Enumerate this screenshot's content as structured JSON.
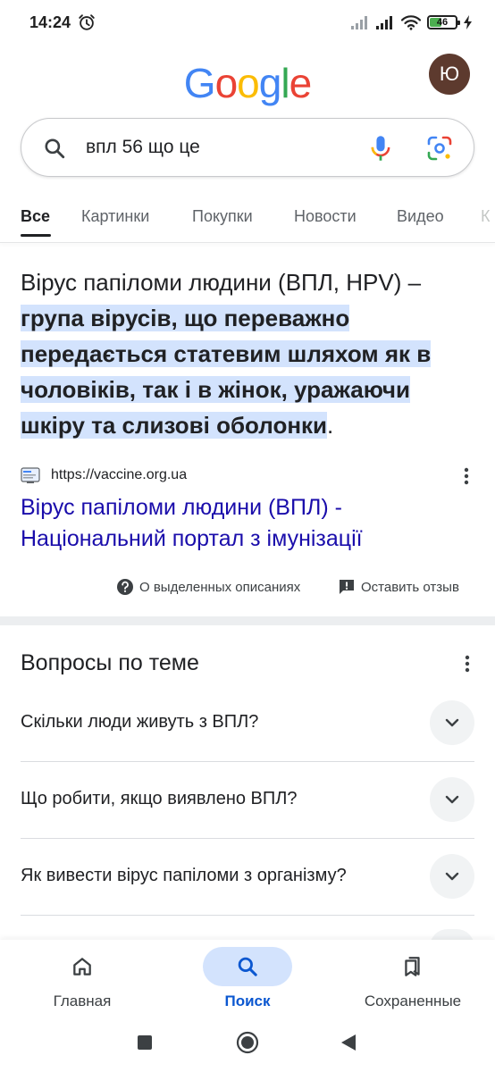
{
  "status_bar": {
    "time": "14:24",
    "battery": "46",
    "battery_level": 0.46
  },
  "header": {
    "logo_letters": [
      "G",
      "o",
      "o",
      "g",
      "l",
      "e"
    ],
    "logo_colors": [
      "#4285F4",
      "#EA4335",
      "#FBBC05",
      "#4285F4",
      "#34A853",
      "#EA4335"
    ],
    "avatar_initial": "Ю"
  },
  "search": {
    "query": "впл 56 що це"
  },
  "tabs": [
    {
      "label": "Все",
      "active": true
    },
    {
      "label": "Картинки",
      "active": false
    },
    {
      "label": "Покупки",
      "active": false
    },
    {
      "label": "Новости",
      "active": false
    },
    {
      "label": "Видео",
      "active": false
    },
    {
      "label": "К",
      "active": false
    }
  ],
  "snippet": {
    "lead": "Вірус папіломи людини (ВПЛ, HPV) – ",
    "highlighted": "група вірусів, що переважно передається статевим шляхом як в чоловіків, так і в жінок, уражаючи шкіру та слизові оболонки",
    "tail": ".",
    "source_url": "https://vaccine.org.ua",
    "result_title": "Вірус папіломи людини (ВПЛ) - Національний портал з імунізації",
    "about_label": "О выделенных описаниях",
    "feedback_label": "Оставить отзыв"
  },
  "related": {
    "title": "Вопросы по теме",
    "questions": [
      "Скільки люди живуть з ВПЛ?",
      "Що робити, якщо виявлено ВПЛ?",
      "Як вивести вірус папіломи з організму?"
    ]
  },
  "bottom_nav": {
    "home": "Главная",
    "search": "Поиск",
    "saved": "Сохраненные"
  },
  "colors": {
    "link": "#1a0dab",
    "highlight": "#d3e3fd",
    "accent": "#0b57d0"
  }
}
